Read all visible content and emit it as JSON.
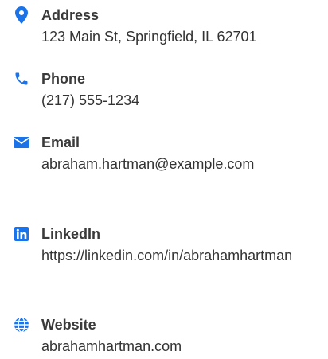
{
  "accent_color": "#1a73e8",
  "contacts": [
    {
      "icon": "map-pin-icon",
      "label": "Address",
      "value": "123 Main St, Springfield, IL 62701"
    },
    {
      "icon": "phone-icon",
      "label": "Phone",
      "value": "(217) 555-1234"
    },
    {
      "icon": "envelope-icon",
      "label": "Email",
      "value": "abraham.hartman@example.com"
    },
    {
      "icon": "linkedin-icon",
      "label": "LinkedIn",
      "value": "https://linkedin.com/in/abrahamhartman"
    },
    {
      "icon": "globe-icon",
      "label": "Website",
      "value": "abrahamhartman.com"
    }
  ]
}
